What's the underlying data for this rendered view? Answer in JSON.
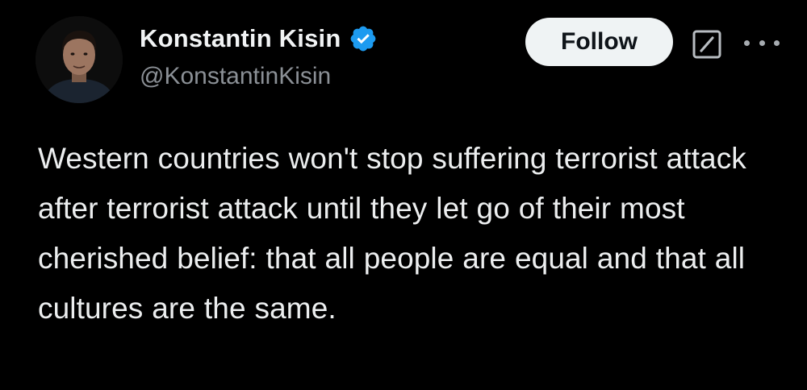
{
  "author": {
    "display_name": "Konstantin Kisin",
    "handle": "@KonstantinKisin",
    "verified": true,
    "avatar_icon": "profile-photo-avatar",
    "verified_icon": "verified-badge-icon",
    "verified_color": "#1d9bf0"
  },
  "actions": {
    "follow_label": "Follow",
    "grok_icon": "grok-icon",
    "more_icon": "more-options-icon"
  },
  "tweet": {
    "text": "Western countries won't stop suffering terrorist attack after terrorist attack until they let go of their most cherished belief: that all people are equal and that all cultures are the same."
  },
  "colors": {
    "background": "#000000",
    "text": "#e7e9ea",
    "secondary_text": "#8b9096",
    "follow_button_bg": "#eff3f4",
    "follow_button_text": "#0f1419"
  }
}
